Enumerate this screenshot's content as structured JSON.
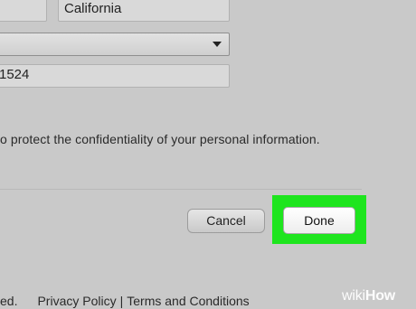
{
  "address": {
    "city_value": "",
    "state_value": "California",
    "country_value": "",
    "phone_value": "1524"
  },
  "privacy_note": "o protect the confidentiality of your personal information.",
  "buttons": {
    "cancel_label": "Cancel",
    "done_label": "Done"
  },
  "footer": {
    "prefix": "ed.",
    "privacy_policy": "Privacy Policy",
    "separator": "|",
    "terms": "Terms and Conditions"
  },
  "watermark": {
    "wiki": "wiki",
    "how": "How"
  },
  "colors": {
    "background": "#c9c9c9",
    "highlight": "#1ee51e"
  },
  "icons": {
    "select_caret": "chevron-down-icon"
  }
}
